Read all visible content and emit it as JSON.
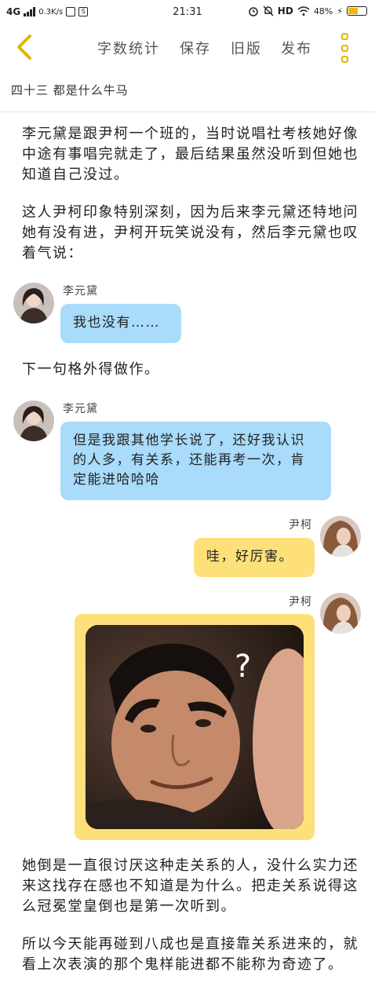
{
  "status_bar": {
    "network": "4G",
    "speed": "0.3K/s",
    "time": "21:31",
    "hd": "HD",
    "battery": "48%"
  },
  "toolbar": {
    "word_count": "字数统计",
    "save": "保存",
    "old_version": "旧版",
    "publish": "发布"
  },
  "chapter": {
    "title": "四十三 都是什么牛马"
  },
  "content": {
    "p1": "李元黛是跟尹柯一个班的，当时说唱社考核她好像中途有事唱完就走了，最后结果虽然没听到但她也知道自己没过。",
    "p2": "这人尹柯印象特别深刻，因为后来李元黛还特地问她有没有进，尹柯开玩笑说没有，然后李元黛也叹着气说：",
    "msg1": {
      "name": "李元黛",
      "text": "我也没有……"
    },
    "p3": "下一句格外得做作。",
    "msg2": {
      "name": "李元黛",
      "text": "但是我跟其他学长说了，还好我认识的人多，有关系，还能再考一次，肯定能进哈哈哈"
    },
    "msg3": {
      "name": "尹柯",
      "text": "哇，好厉害。"
    },
    "msg4": {
      "name": "尹柯",
      "image_mark": "?"
    },
    "p4": "她倒是一直很讨厌这种走关系的人，没什么实力还来这找存在感也不知道是为什么。把走关系说得这么冠冕堂皇倒也是第一次听到。",
    "p5": "所以今天能再碰到八成也是直接靠关系进来的，就看上次表演的那个鬼样能进都不能称为奇迹了。"
  }
}
